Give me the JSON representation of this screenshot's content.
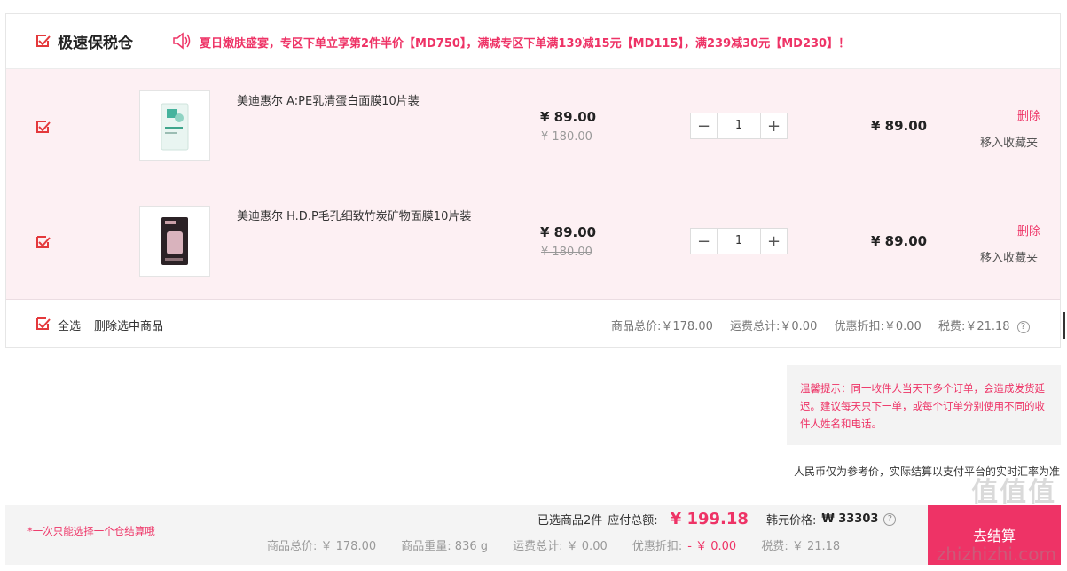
{
  "warehouse": {
    "title": "极速保税仓",
    "promo": "夏日嫩肤盛宴，专区下单立享第2件半价【MD750】，满减专区下单满139减15元【MD115】，满239减30元【MD230】！"
  },
  "items": [
    {
      "name": "美迪惠尔 A:PE乳清蛋白面膜10片装",
      "price": "¥ 89.00",
      "original_price": "¥ 180.00",
      "quantity": "1",
      "subtotal": "¥ 89.00",
      "delete_label": "删除",
      "favorite_label": "移入收藏夹"
    },
    {
      "name": "美迪惠尔 H.D.P毛孔细致竹炭矿物面膜10片装",
      "price": "¥ 89.00",
      "original_price": "¥ 180.00",
      "quantity": "1",
      "subtotal": "¥ 89.00",
      "delete_label": "删除",
      "favorite_label": "移入收藏夹"
    }
  ],
  "footer": {
    "select_all": "全选",
    "delete_selected": "删除选中商品",
    "goods_total": "商品总价:￥178.00",
    "shipping_total": "运费总计:￥0.00",
    "discount": "优惠折扣:￥0.00",
    "tax": "税费:￥21.18",
    "help": "?"
  },
  "tip": "温馨提示：同一收件人当天下多个订单，会造成发货延迟。建议每天只下一单，或每个订单分别使用不同的收件人姓名和电话。",
  "rmb_note": "人民币仅为参考价，实际结算以支付平台的实时汇率为准",
  "summary": {
    "note": "*一次只能选择一个仓结算哦",
    "selected": "已选商品2件",
    "payable_label": "应付总额:",
    "payable": "¥ 199.18",
    "won_label": "韩元价格:",
    "won": "₩ 33303",
    "help": "?",
    "goods_total": "商品总价:  ￥ 178.00",
    "weight": "商品重量:  836 g",
    "shipping": "运费总计:  ￥ 0.00",
    "discount_label": "优惠折扣:",
    "discount": "- ￥ 0.00",
    "tax": "税费:  ￥ 21.18",
    "checkout": "去结算"
  },
  "watermark": {
    "big": "值值值",
    "small": "zhizhizhi.com"
  },
  "colors": {
    "accent": "#ee3366"
  },
  "icons": [
    "checkmark-icon",
    "speaker-icon",
    "minus-icon",
    "plus-icon",
    "question-icon"
  ]
}
